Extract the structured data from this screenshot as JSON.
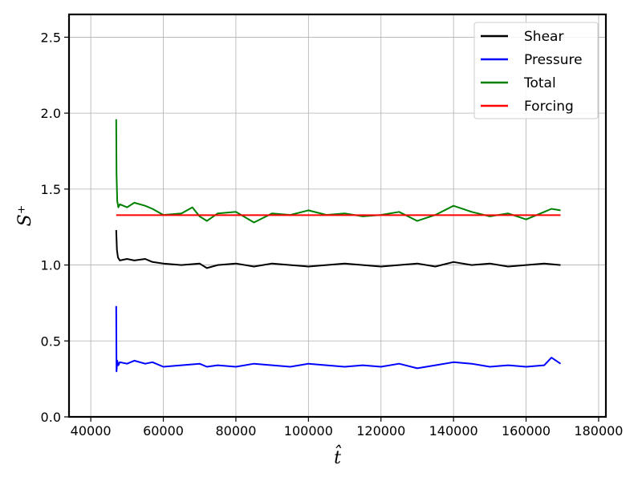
{
  "chart_data": {
    "type": "line",
    "xlabel": "t̂",
    "ylabel": "S⁺",
    "xlim": [
      34000,
      182000
    ],
    "ylim": [
      0,
      2.65
    ],
    "xticks": [
      40000,
      60000,
      80000,
      100000,
      120000,
      140000,
      160000,
      180000
    ],
    "yticks": [
      0.0,
      0.5,
      1.0,
      1.5,
      2.0,
      2.5
    ],
    "xtick_labels": [
      "40000",
      "60000",
      "80000",
      "100000",
      "120000",
      "140000",
      "160000",
      "180000"
    ],
    "ytick_labels": [
      "0.0",
      "0.5",
      "1.0",
      "1.5",
      "2.0",
      "2.5"
    ],
    "grid": true,
    "legend_position": "top-right",
    "series": [
      {
        "name": "Shear",
        "color": "#000000",
        "x": [
          47000,
          47200,
          47500,
          48000,
          50000,
          52000,
          55000,
          57000,
          60000,
          65000,
          70000,
          72000,
          75000,
          80000,
          85000,
          90000,
          95000,
          100000,
          105000,
          110000,
          115000,
          120000,
          125000,
          130000,
          135000,
          140000,
          145000,
          150000,
          155000,
          160000,
          165000,
          169500
        ],
        "y": [
          1.23,
          1.1,
          1.05,
          1.03,
          1.04,
          1.03,
          1.04,
          1.02,
          1.01,
          1.0,
          1.01,
          0.98,
          1.0,
          1.01,
          0.99,
          1.01,
          1.0,
          0.99,
          1.0,
          1.01,
          1.0,
          0.99,
          1.0,
          1.01,
          0.99,
          1.02,
          1.0,
          1.01,
          0.99,
          1.0,
          1.01,
          1.0
        ]
      },
      {
        "name": "Pressure",
        "color": "#0000ff",
        "x": [
          47000,
          47100,
          47300,
          47600,
          48000,
          50000,
          52000,
          55000,
          57000,
          60000,
          65000,
          70000,
          72000,
          75000,
          80000,
          85000,
          90000,
          95000,
          100000,
          105000,
          110000,
          115000,
          120000,
          125000,
          130000,
          135000,
          140000,
          145000,
          150000,
          155000,
          160000,
          165000,
          167000,
          169500
        ],
        "y": [
          0.73,
          0.3,
          0.37,
          0.34,
          0.36,
          0.35,
          0.37,
          0.35,
          0.36,
          0.33,
          0.34,
          0.35,
          0.33,
          0.34,
          0.33,
          0.35,
          0.34,
          0.33,
          0.35,
          0.34,
          0.33,
          0.34,
          0.33,
          0.35,
          0.32,
          0.34,
          0.36,
          0.35,
          0.33,
          0.34,
          0.33,
          0.34,
          0.39,
          0.35
        ]
      },
      {
        "name": "Total",
        "color": "#008000",
        "x": [
          47000,
          47100,
          47300,
          47600,
          48000,
          50000,
          52000,
          55000,
          57000,
          60000,
          65000,
          68000,
          70000,
          72000,
          75000,
          80000,
          85000,
          90000,
          95000,
          100000,
          105000,
          110000,
          115000,
          120000,
          125000,
          130000,
          135000,
          140000,
          145000,
          150000,
          155000,
          160000,
          165000,
          167000,
          169500
        ],
        "y": [
          1.96,
          1.6,
          1.42,
          1.38,
          1.4,
          1.38,
          1.41,
          1.39,
          1.37,
          1.33,
          1.34,
          1.38,
          1.32,
          1.29,
          1.34,
          1.35,
          1.28,
          1.34,
          1.33,
          1.36,
          1.33,
          1.34,
          1.32,
          1.33,
          1.35,
          1.29,
          1.33,
          1.39,
          1.35,
          1.32,
          1.34,
          1.3,
          1.35,
          1.37,
          1.36
        ]
      },
      {
        "name": "Forcing",
        "color": "#ff0000",
        "x": [
          47000,
          169500
        ],
        "y": [
          1.328,
          1.328
        ]
      }
    ]
  }
}
